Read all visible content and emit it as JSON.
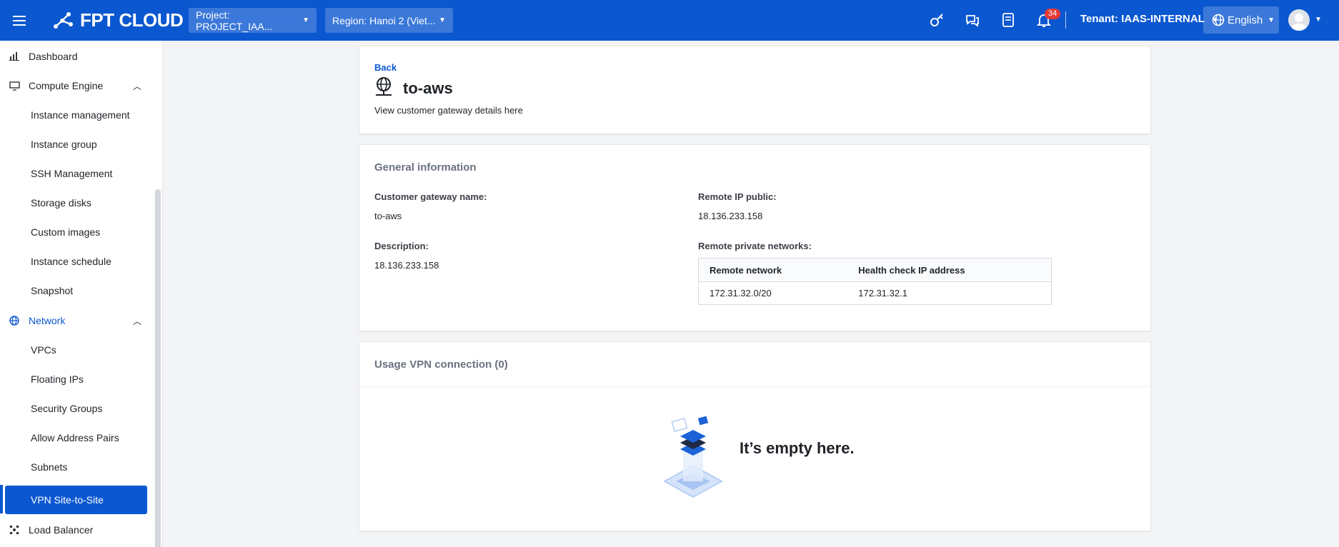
{
  "topbar": {
    "logo_text": "FPT CLOUD",
    "project_label": "Project: PROJECT_IAA...",
    "region_label": "Region: Hanoi 2 (Viet...",
    "notification_count": "34",
    "tenant_label": "Tenant: IAAS-INTERNAL",
    "language": "English"
  },
  "sidebar": {
    "items": [
      {
        "label": "Dashboard"
      },
      {
        "label": "Compute Engine"
      },
      {
        "label": "Instance management"
      },
      {
        "label": "Instance group"
      },
      {
        "label": "SSH Management"
      },
      {
        "label": "Storage disks"
      },
      {
        "label": "Custom images"
      },
      {
        "label": "Instance schedule"
      },
      {
        "label": "Snapshot"
      },
      {
        "label": "Network"
      },
      {
        "label": "VPCs"
      },
      {
        "label": "Floating IPs"
      },
      {
        "label": "Security Groups"
      },
      {
        "label": "Allow Address Pairs"
      },
      {
        "label": "Subnets"
      },
      {
        "label": "VPN Site-to-Site"
      },
      {
        "label": "Load Balancer"
      }
    ]
  },
  "header": {
    "back_label": "Back",
    "title": "to-aws",
    "subtitle": "View customer gateway details here"
  },
  "general": {
    "section_title": "General information",
    "gateway_name_label": "Customer gateway name:",
    "gateway_name_value": "to-aws",
    "description_label": "Description:",
    "description_value": "18.136.233.158",
    "remote_ip_label": "Remote IP public:",
    "remote_ip_value": "18.136.233.158",
    "remote_networks_label": "Remote private networks:",
    "table": {
      "headers": [
        "Remote network",
        "Health check IP address"
      ],
      "rows": [
        [
          "172.31.32.0/20",
          "172.31.32.1"
        ]
      ]
    }
  },
  "usage": {
    "section_title": "Usage VPN connection (0)",
    "empty_text": "It’s empty here."
  }
}
